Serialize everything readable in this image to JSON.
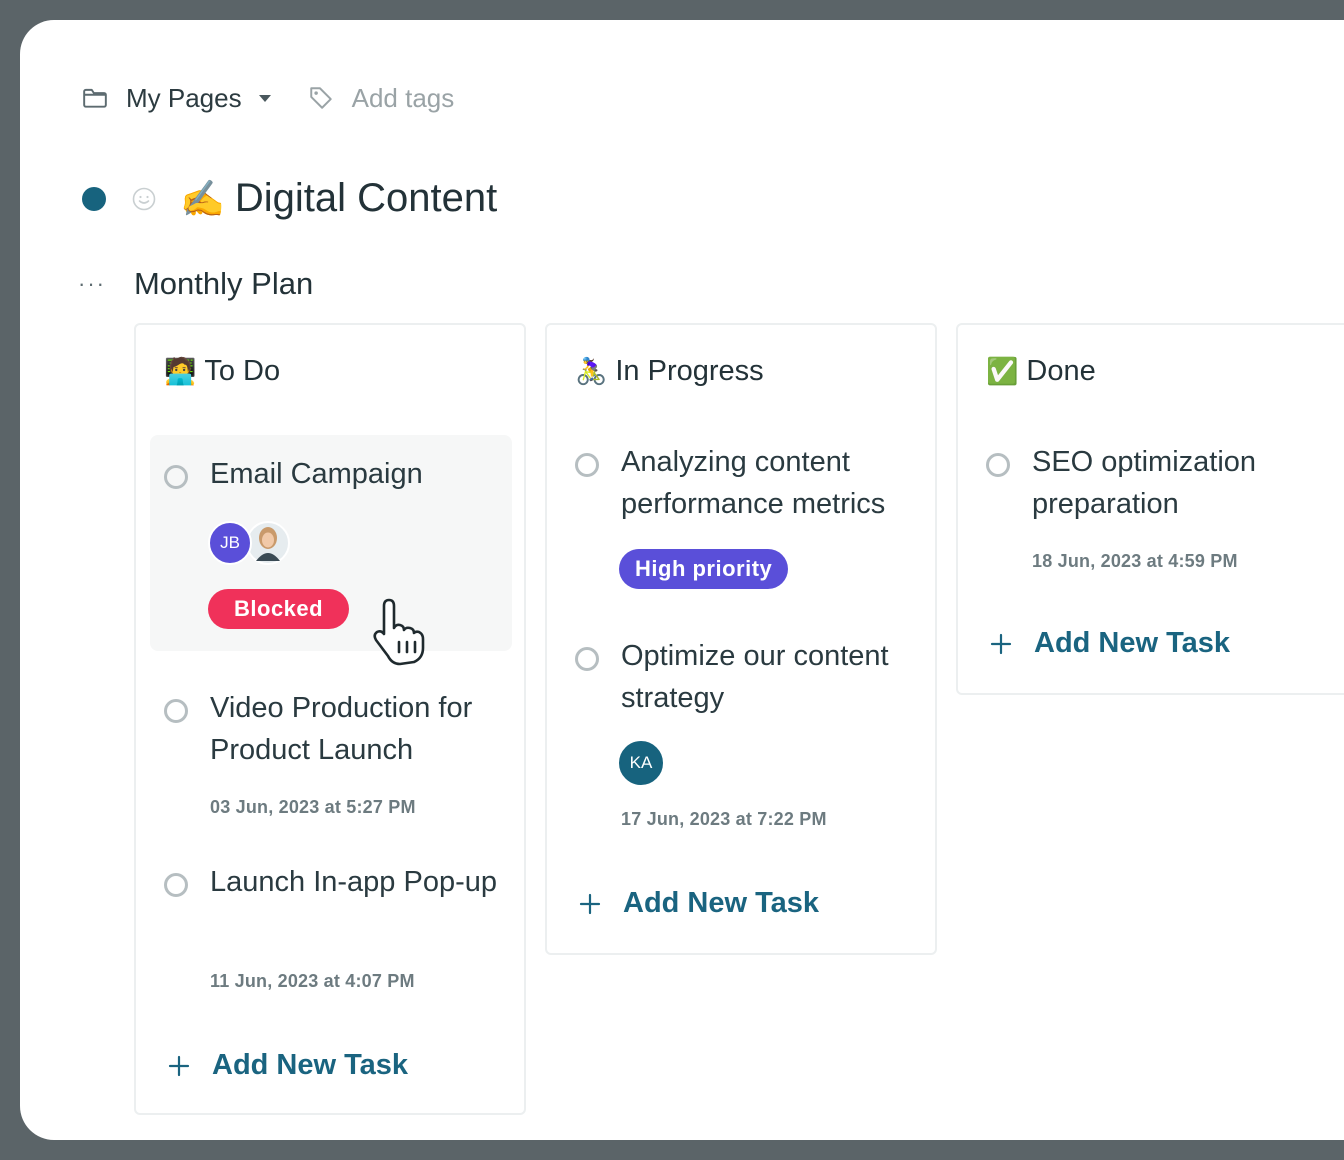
{
  "breadcrumb": {
    "pages_label": "My Pages",
    "tags_placeholder": "Add tags"
  },
  "page": {
    "emoji": "✍️",
    "title": "Digital Content"
  },
  "section": {
    "more": "···",
    "title": "Monthly Plan"
  },
  "columns": [
    {
      "emoji": "🧑‍💻",
      "title": "To Do",
      "add_label": "Add New Task",
      "tasks": [
        {
          "name": "Email Campaign",
          "avatars": [
            "JB"
          ],
          "badge": "Blocked"
        },
        {
          "name": "Video Production for Product Launch",
          "date": "03 Jun, 2023 at 5:27 PM"
        },
        {
          "name": "Launch In-app Pop-up",
          "date": "11 Jun, 2023 at 4:07 PM"
        }
      ]
    },
    {
      "emoji": "🚴‍♀️",
      "title": "In Progress",
      "add_label": "Add New Task",
      "tasks": [
        {
          "name": "Analyzing content performance metrics",
          "badge": "High priority"
        },
        {
          "name": "Optimize our content strategy",
          "avatars": [
            "KA"
          ],
          "date": "17 Jun, 2023 at 7:22 PM"
        }
      ]
    },
    {
      "emoji": "✅",
      "title": "Done",
      "add_label": "Add New Task",
      "tasks": [
        {
          "name": "SEO optimization preparation",
          "date": "18 Jun, 2023 at 4:59 PM"
        }
      ]
    }
  ],
  "colors": {
    "accent": "#1a6480",
    "blocked": "#f0315a",
    "high_priority": "#5a4fd9",
    "avatar_jb": "#5a4fd9",
    "avatar_ka": "#17637e"
  }
}
